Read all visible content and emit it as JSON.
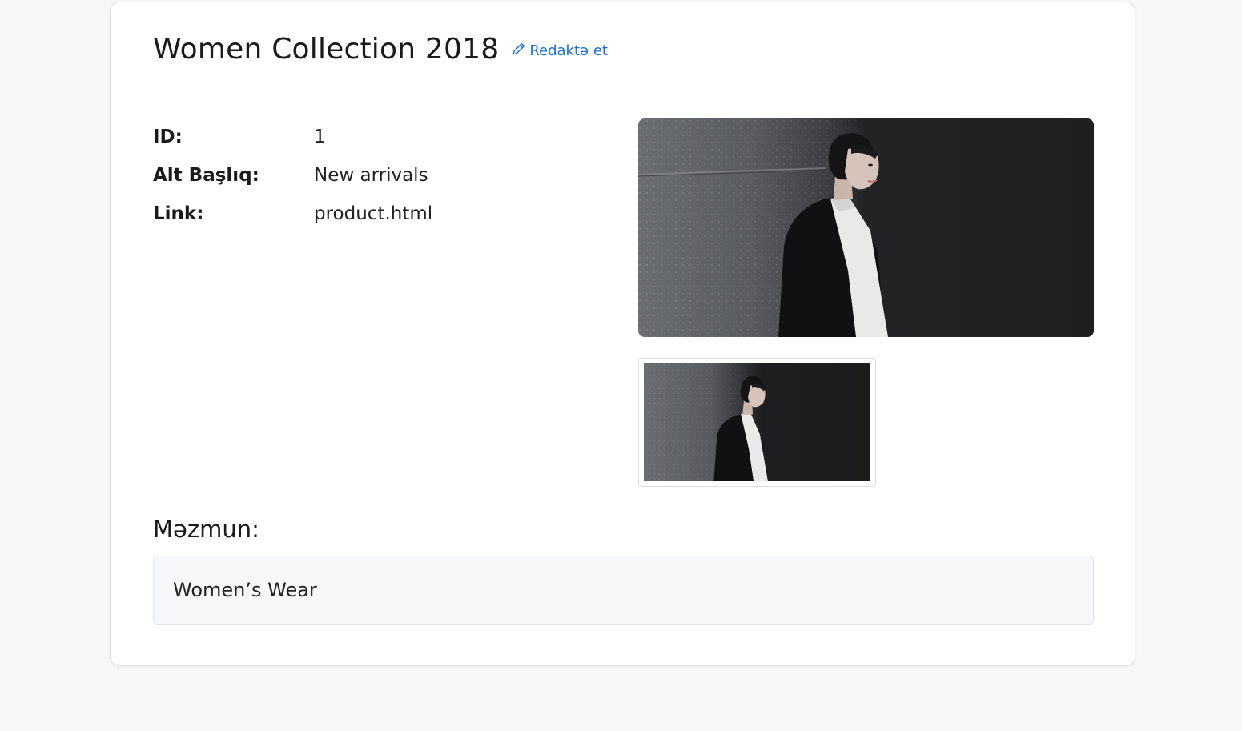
{
  "header": {
    "title": "Women Collection 2018",
    "edit_label": "Redaktə et",
    "edit_icon": "pencil-icon",
    "accent_color": "#1a6fe0"
  },
  "details": {
    "rows": [
      {
        "label": "ID:",
        "value": "1"
      },
      {
        "label": "Alt Başlıq:",
        "value": "New arrivals"
      },
      {
        "label": "Link:",
        "value": "product.html"
      }
    ]
  },
  "images": {
    "main_alt": "fashion-photo",
    "thumb_alt": "fashion-photo-thumbnail"
  },
  "content": {
    "heading": "Məzmun:",
    "body": "Women’s Wear"
  }
}
